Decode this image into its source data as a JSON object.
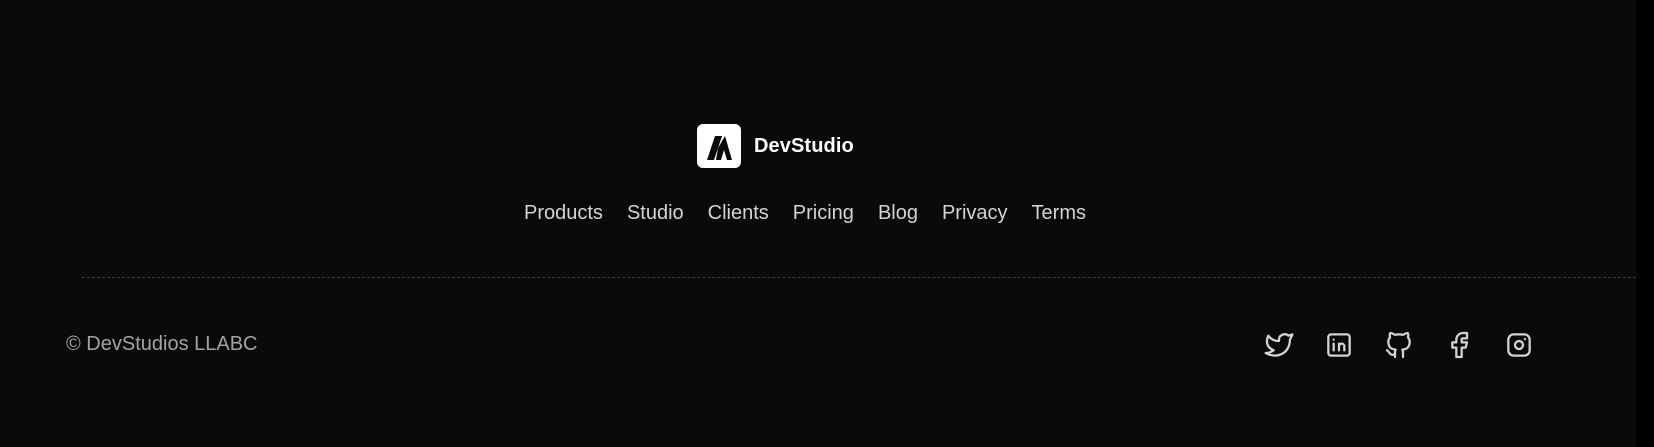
{
  "brand": {
    "name": "DevStudio",
    "logo_icon": "devstudio-logo-icon"
  },
  "nav": {
    "items": [
      {
        "label": "Products"
      },
      {
        "label": "Studio"
      },
      {
        "label": "Clients"
      },
      {
        "label": "Pricing"
      },
      {
        "label": "Blog"
      },
      {
        "label": "Privacy"
      },
      {
        "label": "Terms"
      }
    ]
  },
  "footer": {
    "copyright": "© DevStudios LLABC"
  },
  "social": {
    "icons": [
      "twitter-icon",
      "linkedin-icon",
      "github-icon",
      "facebook-icon",
      "instagram-icon"
    ]
  },
  "colors": {
    "background": "#0a0a0a",
    "text_primary": "#ffffff",
    "text_nav": "#d4d4d4",
    "text_muted": "#a3a3a3"
  }
}
